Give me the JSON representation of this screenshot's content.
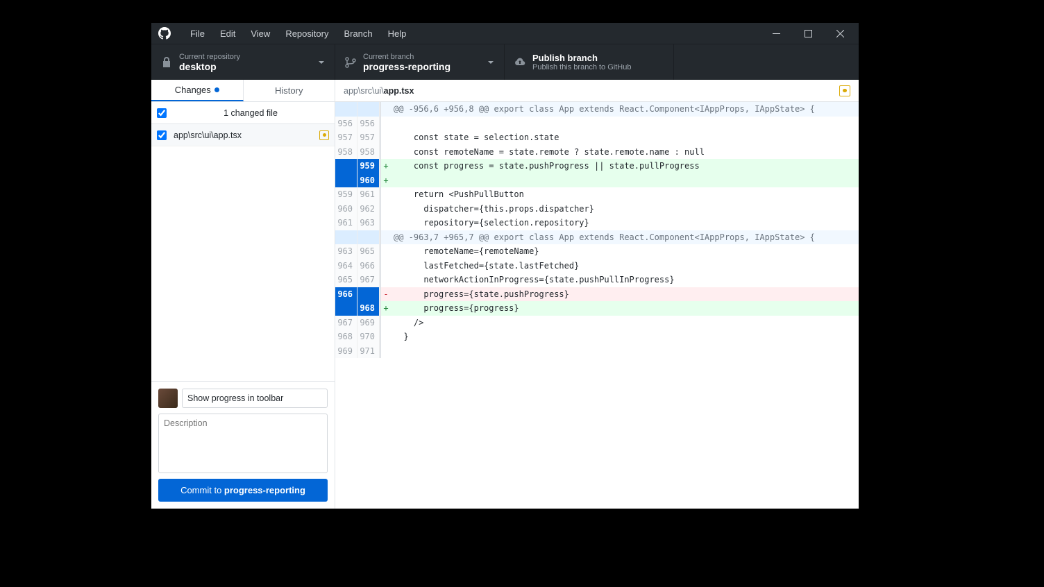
{
  "menu": [
    "File",
    "Edit",
    "View",
    "Repository",
    "Branch",
    "Help"
  ],
  "toolbar": {
    "repo": {
      "label": "Current repository",
      "value": "desktop"
    },
    "branch": {
      "label": "Current branch",
      "value": "progress-reporting"
    },
    "publish": {
      "title": "Publish branch",
      "sub": "Publish this branch to GitHub"
    }
  },
  "tabs": {
    "changes": "Changes",
    "history": "History"
  },
  "files": {
    "count_label": "1 changed file",
    "items": [
      {
        "path": "app\\src\\ui\\app.tsx"
      }
    ]
  },
  "commit": {
    "summary": "Show progress in toolbar",
    "desc_placeholder": "Description",
    "btn_prefix": "Commit to ",
    "btn_branch": "progress-reporting"
  },
  "diff": {
    "path_prefix": "app\\src\\ui\\",
    "path_name": "app.tsx",
    "lines": [
      {
        "t": "hunk",
        "a": "",
        "b": "",
        "m": " ",
        "c": "@@ -956,6 +956,8 @@ export class App extends React.Component<IAppProps, IAppState> {"
      },
      {
        "t": "ctx",
        "a": "956",
        "b": "956",
        "m": " ",
        "c": ""
      },
      {
        "t": "ctx",
        "a": "957",
        "b": "957",
        "m": " ",
        "c": "    const state = selection.state"
      },
      {
        "t": "ctx",
        "a": "958",
        "b": "958",
        "m": " ",
        "c": "    const remoteName = state.remote ? state.remote.name : null"
      },
      {
        "t": "add",
        "a": "",
        "b": "959",
        "m": "+",
        "c": "    const progress = state.pushProgress || state.pullProgress",
        "sel": true
      },
      {
        "t": "add",
        "a": "",
        "b": "960",
        "m": "+",
        "c": "",
        "sel": true
      },
      {
        "t": "ctx",
        "a": "959",
        "b": "961",
        "m": " ",
        "c": "    return <PushPullButton"
      },
      {
        "t": "ctx",
        "a": "960",
        "b": "962",
        "m": " ",
        "c": "      dispatcher={this.props.dispatcher}"
      },
      {
        "t": "ctx",
        "a": "961",
        "b": "963",
        "m": " ",
        "c": "      repository={selection.repository}"
      },
      {
        "t": "hunk",
        "a": "",
        "b": "",
        "m": " ",
        "c": "@@ -963,7 +965,7 @@ export class App extends React.Component<IAppProps, IAppState> {"
      },
      {
        "t": "ctx",
        "a": "963",
        "b": "965",
        "m": " ",
        "c": "      remoteName={remoteName}"
      },
      {
        "t": "ctx",
        "a": "964",
        "b": "966",
        "m": " ",
        "c": "      lastFetched={state.lastFetched}"
      },
      {
        "t": "ctx",
        "a": "965",
        "b": "967",
        "m": " ",
        "c": "      networkActionInProgress={state.pushPullInProgress}"
      },
      {
        "t": "del",
        "a": "966",
        "b": "",
        "m": "-",
        "c": "      progress={state.pushProgress}",
        "sel": true
      },
      {
        "t": "add",
        "a": "",
        "b": "968",
        "m": "+",
        "c": "      progress={progress}",
        "sel": true
      },
      {
        "t": "ctx",
        "a": "967",
        "b": "969",
        "m": " ",
        "c": "    />"
      },
      {
        "t": "ctx",
        "a": "968",
        "b": "970",
        "m": " ",
        "c": "  }"
      },
      {
        "t": "ctx",
        "a": "969",
        "b": "971",
        "m": " ",
        "c": ""
      }
    ]
  }
}
